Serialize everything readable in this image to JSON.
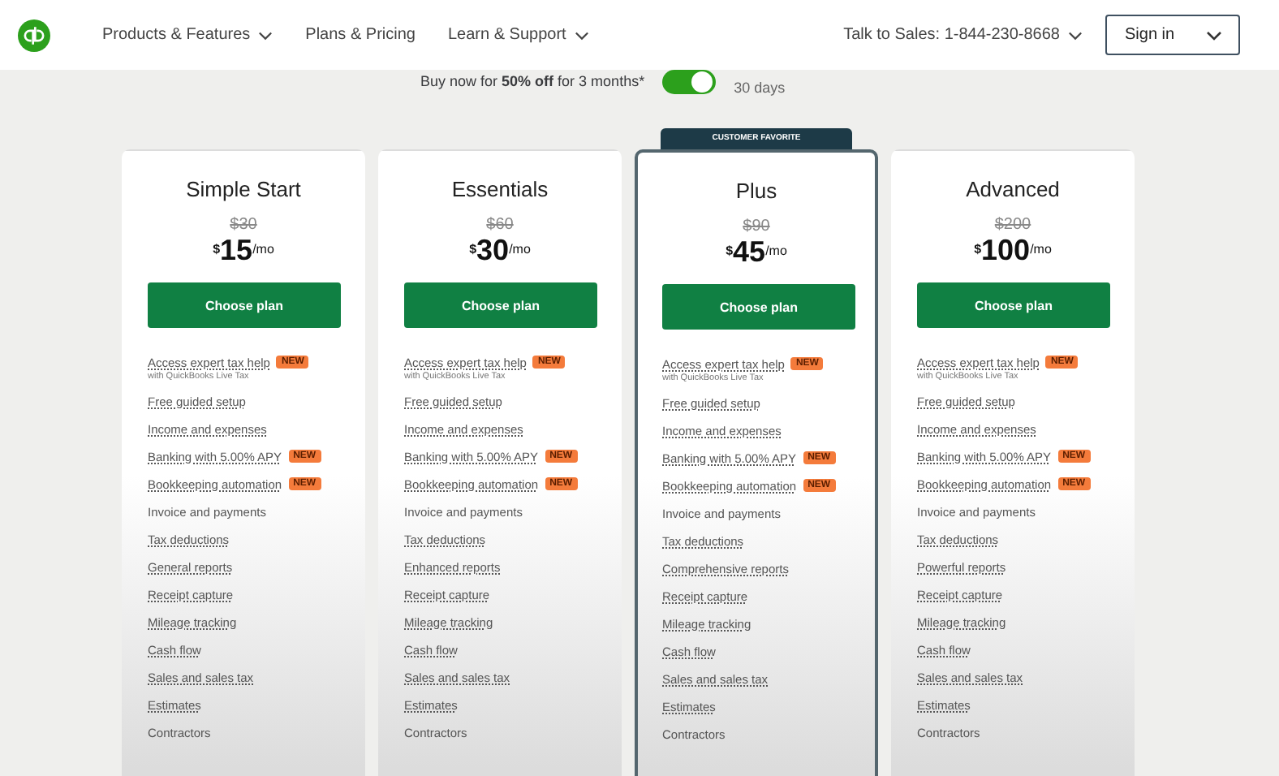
{
  "header": {
    "nav": [
      {
        "label": "Products & Features",
        "dropdown": true
      },
      {
        "label": "Plans & Pricing",
        "dropdown": false
      },
      {
        "label": "Learn & Support",
        "dropdown": true
      }
    ],
    "sales": "Talk to Sales: 1-844-230-8668",
    "sign_in": "Sign in"
  },
  "promo": {
    "text": "Buy now for **50% off** for 3 months*",
    "toggle_on": true,
    "trial": "30 days"
  },
  "plans": [
    {
      "name": "Simple Start",
      "old_price": "$30",
      "currency": "$",
      "price": "15",
      "period": "/mo",
      "button": "Choose plan",
      "featured": false,
      "features": [
        {
          "text": "Access expert tax help",
          "sub": "with QuickBooks Live Tax",
          "badge": "NEW",
          "underlined": true
        },
        {
          "text": "Free guided setup",
          "underlined": true
        },
        {
          "text": "Income and expenses",
          "underlined": true
        },
        {
          "text": "Banking with 5.00% APY",
          "badge": "NEW",
          "underlined": true
        },
        {
          "text": "Bookkeeping automation",
          "badge": "NEW",
          "underlined": true
        },
        {
          "text": "Invoice and payments",
          "underlined": false
        },
        {
          "text": "Tax deductions",
          "underlined": true
        },
        {
          "text": "General reports",
          "underlined": true
        },
        {
          "text": "Receipt capture",
          "underlined": true
        },
        {
          "text": "Mileage tracking",
          "underlined": true
        },
        {
          "text": "Cash flow",
          "underlined": true
        },
        {
          "text": "Sales and sales tax",
          "underlined": true
        },
        {
          "text": "Estimates",
          "underlined": true
        },
        {
          "text": "Contractors",
          "underlined": false
        }
      ]
    },
    {
      "name": "Essentials",
      "old_price": "$60",
      "currency": "$",
      "price": "30",
      "period": "/mo",
      "button": "Choose plan",
      "featured": false,
      "features": [
        {
          "text": "Access expert tax help",
          "sub": "with QuickBooks Live Tax",
          "badge": "NEW",
          "underlined": true
        },
        {
          "text": "Free guided setup",
          "underlined": true
        },
        {
          "text": "Income and expenses",
          "underlined": true
        },
        {
          "text": "Banking with 5.00% APY",
          "badge": "NEW",
          "underlined": true
        },
        {
          "text": "Bookkeeping automation",
          "badge": "NEW",
          "underlined": true
        },
        {
          "text": "Invoice and payments",
          "underlined": false
        },
        {
          "text": "Tax deductions",
          "underlined": true
        },
        {
          "text": "Enhanced reports",
          "underlined": true
        },
        {
          "text": "Receipt capture",
          "underlined": true
        },
        {
          "text": "Mileage tracking",
          "underlined": true
        },
        {
          "text": "Cash flow",
          "underlined": true
        },
        {
          "text": "Sales and sales tax",
          "underlined": true
        },
        {
          "text": "Estimates",
          "underlined": true
        },
        {
          "text": "Contractors",
          "underlined": false
        }
      ]
    },
    {
      "name": "Plus",
      "old_price": "$90",
      "currency": "$",
      "price": "45",
      "period": "/mo",
      "button": "Choose plan",
      "featured": true,
      "ribbon": "CUSTOMER FAVORITE",
      "features": [
        {
          "text": "Access expert tax help",
          "sub": "with QuickBooks Live Tax",
          "badge": "NEW",
          "underlined": true
        },
        {
          "text": "Free guided setup",
          "underlined": true
        },
        {
          "text": "Income and expenses",
          "underlined": true
        },
        {
          "text": "Banking with 5.00% APY",
          "badge": "NEW",
          "underlined": true
        },
        {
          "text": "Bookkeeping automation",
          "badge": "NEW",
          "underlined": true
        },
        {
          "text": "Invoice and payments",
          "underlined": false
        },
        {
          "text": "Tax deductions",
          "underlined": true
        },
        {
          "text": "Comprehensive reports",
          "underlined": true
        },
        {
          "text": "Receipt capture",
          "underlined": true
        },
        {
          "text": "Mileage tracking",
          "underlined": true
        },
        {
          "text": "Cash flow",
          "underlined": true
        },
        {
          "text": "Sales and sales tax",
          "underlined": true
        },
        {
          "text": "Estimates",
          "underlined": true
        },
        {
          "text": "Contractors",
          "underlined": false
        }
      ]
    },
    {
      "name": "Advanced",
      "old_price": "$200",
      "currency": "$",
      "price": "100",
      "period": "/mo",
      "button": "Choose plan",
      "featured": false,
      "features": [
        {
          "text": "Access expert tax help",
          "sub": "with QuickBooks Live Tax",
          "badge": "NEW",
          "underlined": true
        },
        {
          "text": "Free guided setup",
          "underlined": true
        },
        {
          "text": "Income and expenses",
          "underlined": true
        },
        {
          "text": "Banking with 5.00% APY",
          "badge": "NEW",
          "underlined": true
        },
        {
          "text": "Bookkeeping automation",
          "badge": "NEW",
          "underlined": true
        },
        {
          "text": "Invoice and payments",
          "underlined": false
        },
        {
          "text": "Tax deductions",
          "underlined": true
        },
        {
          "text": "Powerful reports",
          "underlined": true
        },
        {
          "text": "Receipt capture",
          "underlined": true
        },
        {
          "text": "Mileage tracking",
          "underlined": true
        },
        {
          "text": "Cash flow",
          "underlined": true
        },
        {
          "text": "Sales and sales tax",
          "underlined": true
        },
        {
          "text": "Estimates",
          "underlined": true
        },
        {
          "text": "Contractors",
          "underlined": false
        }
      ]
    }
  ]
}
